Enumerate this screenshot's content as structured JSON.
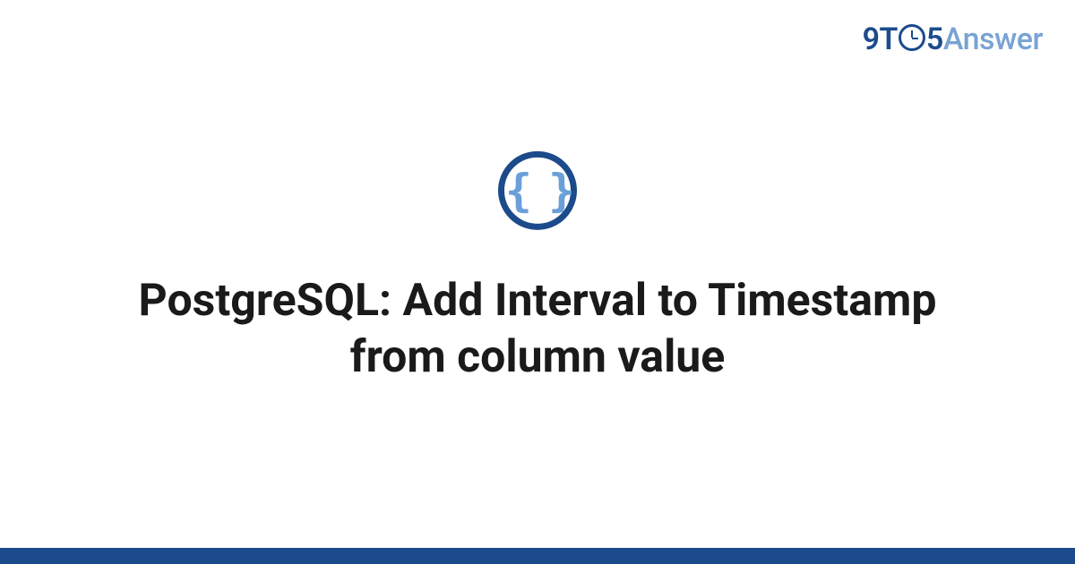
{
  "brand": {
    "part1": "9T",
    "part2": "5",
    "part3": "Answer"
  },
  "icon": {
    "braces_text": "{ }"
  },
  "title": "PostgreSQL: Add Interval to Timestamp from column value",
  "colors": {
    "primary": "#1c4b8b",
    "accent": "#6b9fd8"
  }
}
